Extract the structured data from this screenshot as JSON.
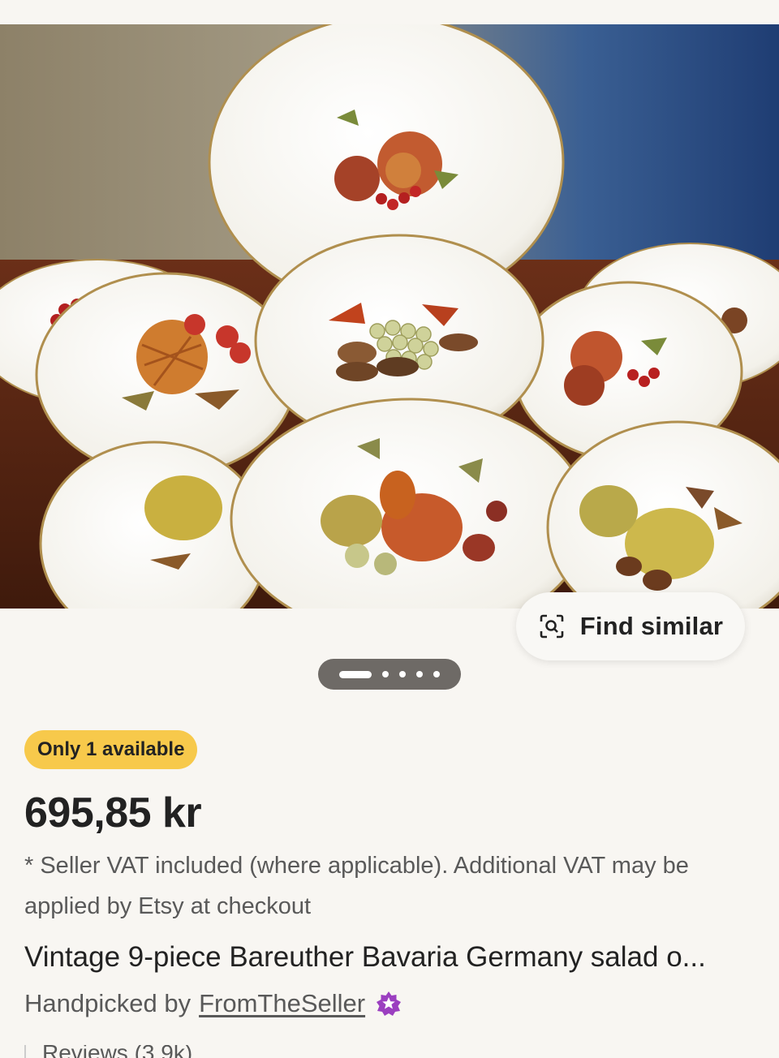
{
  "listing": {
    "image_alt": "Set of vintage plates decorated with fruit motifs",
    "find_similar_label": "Find similar",
    "gallery_pages": 5,
    "gallery_active_index": 0,
    "stock_badge": "Only 1 available",
    "price": "695,85 kr",
    "vat_note": "* Seller VAT included (where applicable). Additional VAT may be applied by Etsy at checkout",
    "title": "Vintage 9-piece Bareuther Bavaria Germany salad o...",
    "handpicked_prefix": "Handpicked by",
    "seller_name": "FromTheSeller",
    "reviews_peek": "Reviews (3.9k)"
  },
  "colors": {
    "badge": "#f7c94b",
    "pager_bg": "#6e6a66",
    "star_badge": "#9b3fc0",
    "page_bg": "#f8f6f2"
  },
  "icons": {
    "find_similar": "visual-search-icon",
    "seller_badge": "star-seller-icon"
  }
}
